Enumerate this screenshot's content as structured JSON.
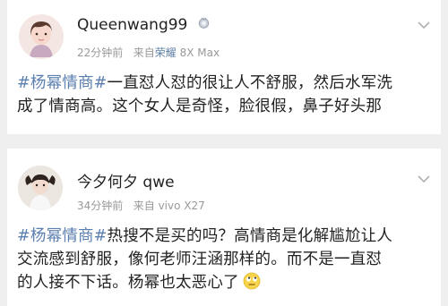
{
  "posts": [
    {
      "username": "Queenwang99",
      "time": "22分钟前",
      "source_prefix": "来自",
      "device_brand": "荣耀",
      "device_model": "8X Max",
      "topic": "#杨幂情商#",
      "line1_rest": "一直怼人怼的很让人不舒服，然后水军洗",
      "line2": "成了情商高。这个女人是奇怪，脸很假，鼻子好头那"
    },
    {
      "username": "今夕何夕 qwe",
      "time": "34分钟前",
      "source_prefix": "来自",
      "device_brand": "vivo",
      "device_model": "X27",
      "topic": "#杨幂情商#",
      "line1_rest": "热搜不是买的吗？高情商是化解尴尬让人",
      "line2": "交流感到舒服，像何老师汪涵那样的。而不是一直怼",
      "line3": "的人接不下话。杨幂也太恶心了"
    }
  ],
  "colors": {
    "topic": "#5b7fb0",
    "meta": "#999999",
    "device_accent": "#5d7fa3",
    "background": "#efefef"
  },
  "icons": {
    "badge": "medal-badge-icon",
    "more": "chevron-down-icon",
    "emoji": "rolling-eyes-emoji-icon"
  }
}
